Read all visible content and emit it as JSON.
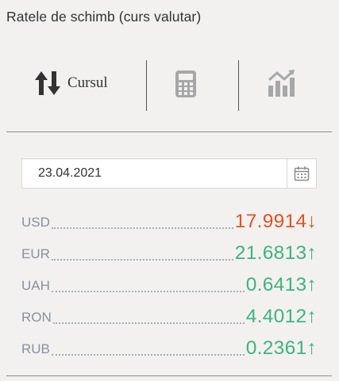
{
  "title": "Ratele de schimb (curs valutar)",
  "tabs": [
    {
      "label": "Cursul",
      "icon": "up-down-arrows-icon"
    },
    {
      "label": "",
      "icon": "calculator-icon"
    },
    {
      "label": "",
      "icon": "bar-chart-icon"
    }
  ],
  "date": {
    "value": "23.04.2021",
    "icon": "calendar-icon"
  },
  "rates": [
    {
      "code": "USD",
      "value": "17.9914",
      "arrow": "↓",
      "color": "#e0531f"
    },
    {
      "code": "EUR",
      "value": "21.6813",
      "arrow": "↑",
      "color": "#3fb27f"
    },
    {
      "code": "UAH",
      "value": "0.6413",
      "arrow": "↑",
      "color": "#3fb27f"
    },
    {
      "code": "RON",
      "value": "4.4012",
      "arrow": "↑",
      "color": "#3fb27f"
    },
    {
      "code": "RUB",
      "value": "0.2361",
      "arrow": "↑",
      "color": "#3fb27f"
    }
  ],
  "colors": {
    "down": "#e0531f",
    "up": "#3fb27f",
    "icon_inactive": "#a7a7a7",
    "icon_active": "#333333"
  }
}
